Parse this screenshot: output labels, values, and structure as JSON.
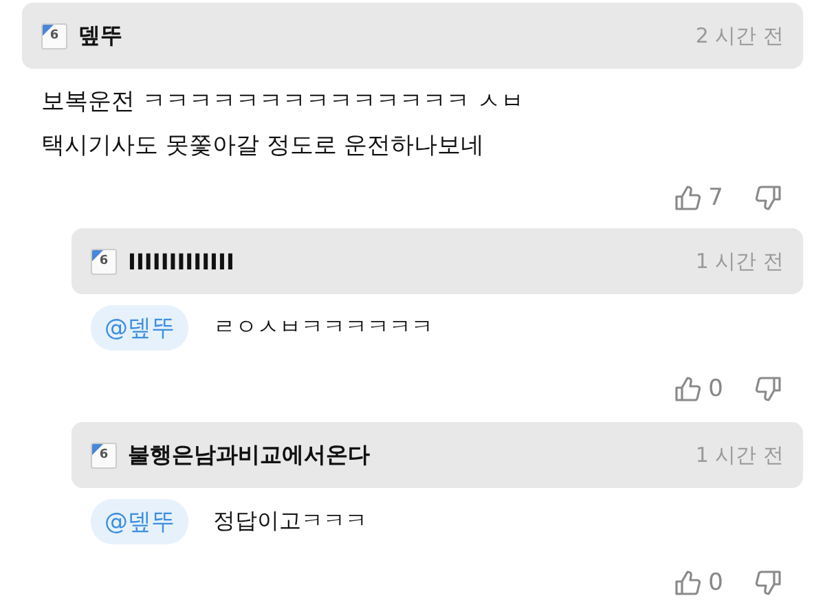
{
  "comment": {
    "author": "뎊뚜",
    "level": "6",
    "time": "2 시간 전",
    "lines": [
      "보복운전 ㅋㅋㅋㅋㅋㅋㅋㅋㅋㅋㅋㅋㅋㅋ ㅅㅂ",
      "택시기사도 못쫓아갈 정도로 운전하나보네"
    ],
    "likes": "7",
    "replies": [
      {
        "author": "IIIIIIIIIIIII",
        "level": "6",
        "time": "1 시간 전",
        "mention": "@뎊뚜",
        "text": "ㄹㅇㅅㅂㅋㅋㅋㅋㅋㅋ",
        "likes": "0"
      },
      {
        "author": "불행은남과비교에서온다",
        "level": "6",
        "time": "1 시간 전",
        "mention": "@뎊뚜",
        "text": "정답이고ㅋㅋㅋ",
        "likes": "0"
      }
    ]
  }
}
